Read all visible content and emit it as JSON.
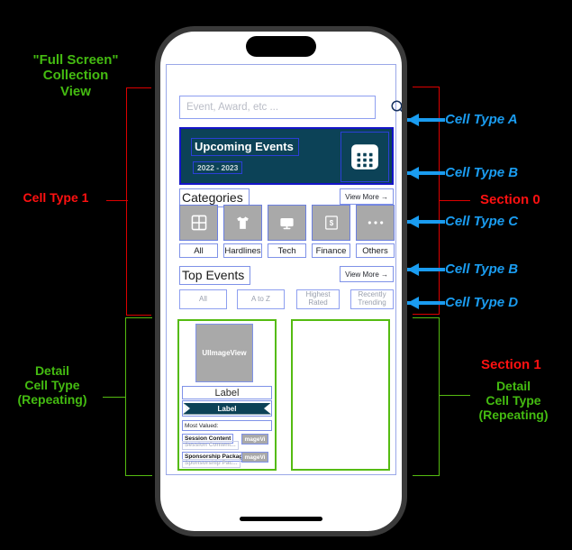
{
  "annotations": {
    "left_top": "\"Full Screen\"\nCollection\nView",
    "left_cell_type_1": "Cell Type 1",
    "left_detail": "Detail\nCell Type\n(Repeating)",
    "right_a": "Cell Type A",
    "right_b1": "Cell Type B",
    "right_c": "Cell Type C",
    "right_b2": "Cell Type B",
    "right_d": "Cell Type D",
    "section_0": "Section 0",
    "section_1": "Section 1",
    "right_detail": "Detail\nCell Type\n(Repeating)",
    "colors": {
      "green": "#44bb11",
      "red": "#ff1111",
      "blue": "#1a9cf0"
    }
  },
  "phone": {
    "search": {
      "placeholder": "Event, Award, etc ...",
      "icon": "search-icon"
    },
    "banner": {
      "title": "Upcoming Events",
      "subtitle": "2022 - 2023",
      "icon": "calendar-icon",
      "bg_color": "#0c4257"
    },
    "categories_section": {
      "title": "Categories",
      "view_more": "View More →",
      "items": [
        {
          "label": "All",
          "icon": "grid-icon"
        },
        {
          "label": "Hardlines",
          "icon": "tshirt-icon"
        },
        {
          "label": "Tech",
          "icon": "monitor-icon"
        },
        {
          "label": "Finance",
          "icon": "dollar-bill-icon"
        },
        {
          "label": "Others",
          "icon": "ellipsis-icon"
        }
      ]
    },
    "top_events_section": {
      "title": "Top Events",
      "view_more": "View More →",
      "filters": [
        "All",
        "A to Z",
        "Highest\nRated",
        "Recently\nTrending"
      ]
    },
    "detail_cell": {
      "image_placeholder": "UIImageView",
      "label": "Label",
      "ribbon_label": "Label",
      "most_valued": "Most Valued:",
      "rows": [
        {
          "text": "Session Content",
          "ghost": "Session Content...",
          "thumb": "mageVi"
        },
        {
          "text": "Sponsorship Packages",
          "ghost": "Sponsorship Pac...",
          "thumb": "mageVi"
        }
      ]
    }
  }
}
